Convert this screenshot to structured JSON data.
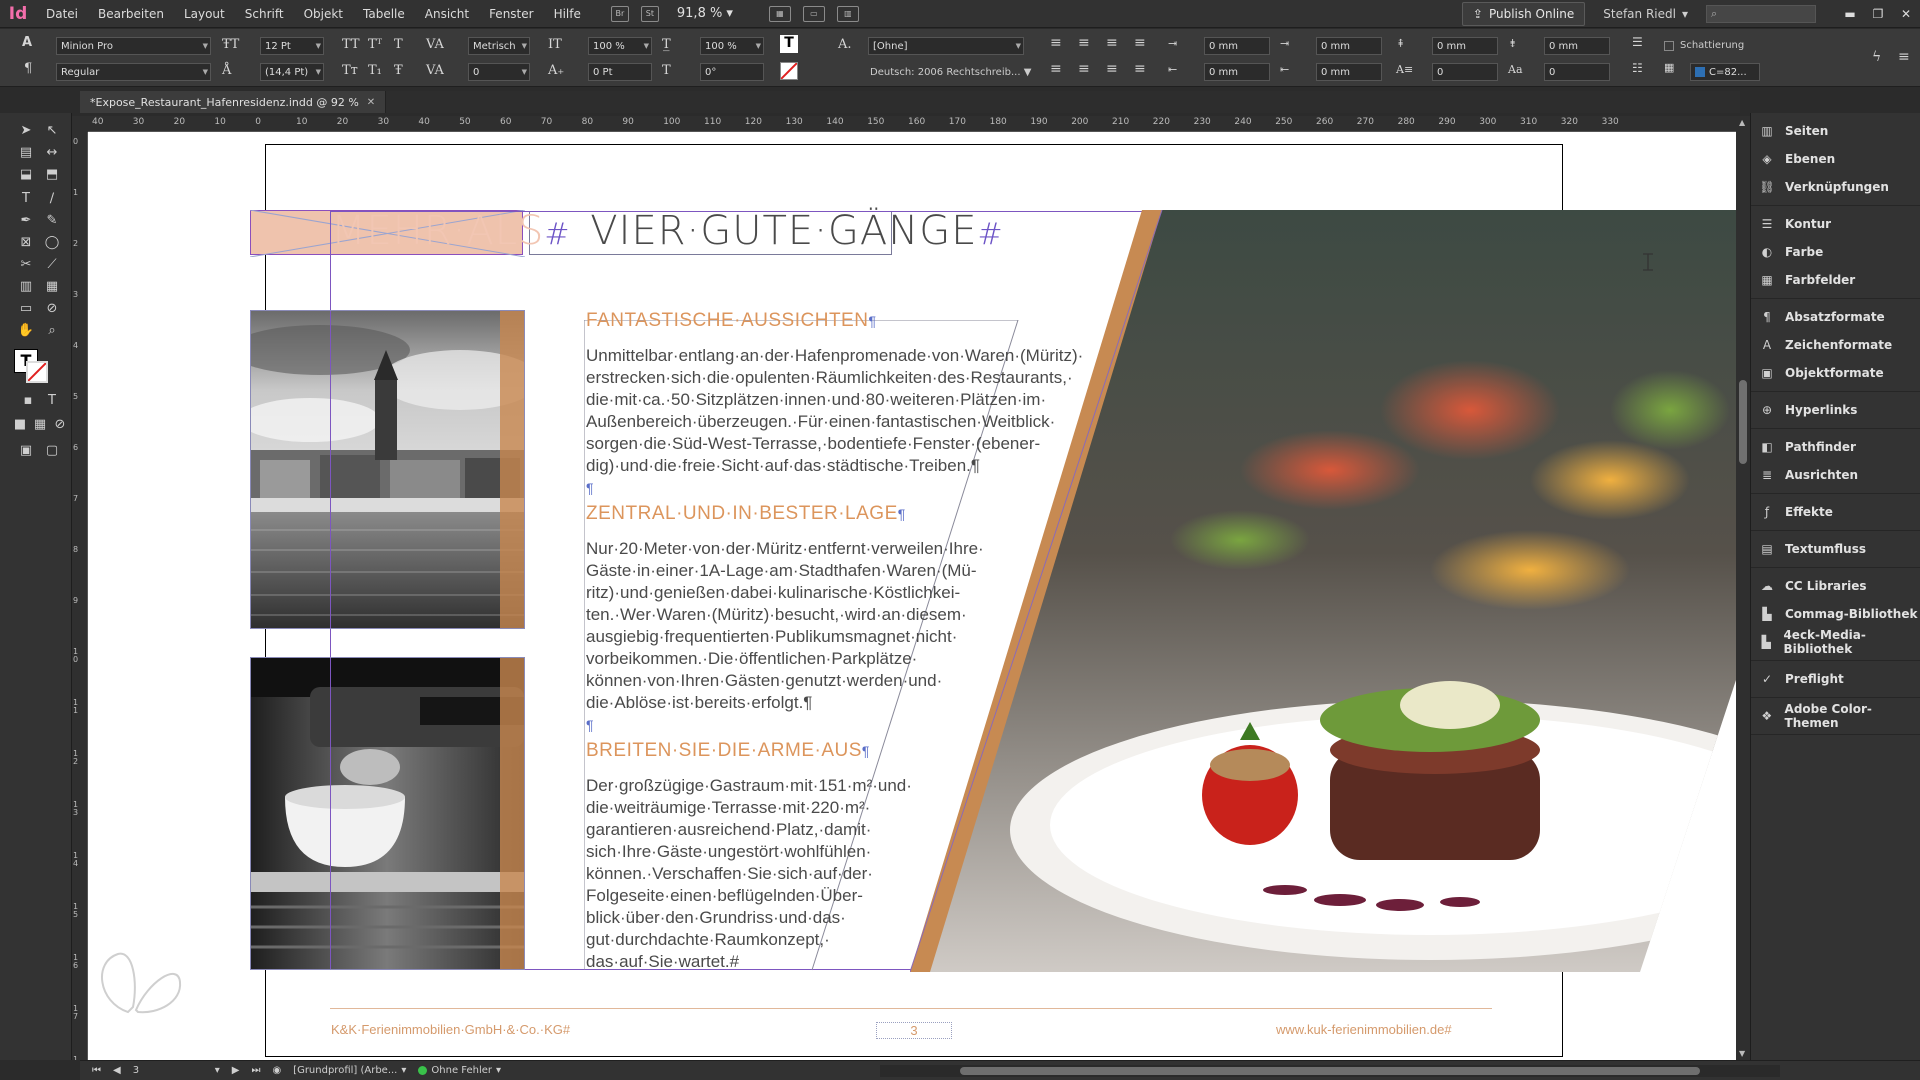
{
  "app": {
    "logo": "Id",
    "zoom": "91,8 %"
  },
  "menu": [
    "Datei",
    "Bearbeiten",
    "Layout",
    "Schrift",
    "Objekt",
    "Tabelle",
    "Ansicht",
    "Fenster",
    "Hilfe"
  ],
  "menubar_icons": {
    "br": "Br",
    "st": "St"
  },
  "publish_label": "Publish Online",
  "user": "Stefan Riedl",
  "control": {
    "font_family": "Minion Pro",
    "font_style": "Regular",
    "font_size": "12 Pt",
    "leading": "(14,4 Pt)",
    "kerning": "Metrisch",
    "tracking": "0",
    "scale_v": "100 %",
    "scale_h": "100 %",
    "baseline": "0 Pt",
    "skew": "0°",
    "char_style": "[Ohne]",
    "language": "Deutsch: 2006 Rechtschreib...",
    "indent_left": "0 mm",
    "indent_first": "0 mm",
    "indent_right": "0 mm",
    "indent_last": "0 mm",
    "space_before": "0 mm",
    "space_after": "0 mm",
    "drop_lines": "0",
    "drop_chars": "0",
    "shading_label": "Schattierung",
    "shading_color": "C=82..."
  },
  "doc_tab": "*Expose_Restaurant_Hafenresidenz.indd @ 92 %",
  "ruler_h": [
    "40",
    "30",
    "20",
    "10",
    "0",
    "10",
    "20",
    "30",
    "40",
    "50",
    "60",
    "70",
    "80",
    "90",
    "100",
    "110",
    "120",
    "130",
    "140",
    "150",
    "160",
    "170",
    "180",
    "190",
    "200",
    "210",
    "220",
    "230",
    "240",
    "250",
    "260",
    "270",
    "280",
    "290",
    "300",
    "310",
    "320",
    "330"
  ],
  "ruler_v": [
    "0",
    "1",
    "2",
    "3",
    "4",
    "5",
    "6",
    "7",
    "8",
    "9",
    "10",
    "11",
    "12",
    "13",
    "14",
    "15",
    "16",
    "17",
    "18",
    "19"
  ],
  "page": {
    "title_part1": "MEHR·ALS",
    "title_part2": "VIER·GUTE·GÄNGE",
    "hash": "#",
    "sections": [
      {
        "heading": "FANTASTISCHE·AUSSICHTEN",
        "lines": [
          "Unmittelbar·entlang·an·der·Hafenpromenade·von·Waren·(Müritz)·",
          "erstrecken·sich·die·opulenten·Räumlichkeiten·des·Restaurants,·",
          "die·mit·ca.·50·Sitzplätzen·innen·und·80·weiteren·Plätzen·im·",
          "Außenbereich·überzeugen.·Für·einen·fantastischen·Weitblick·",
          "sorgen·die·Süd-West-Terrasse,·bodentiefe·Fenster·(ebener-",
          "dig)·und·die·freie·Sicht·auf·das·städtische·Treiben.¶"
        ]
      },
      {
        "heading": "ZENTRAL·UND·IN·BESTER·LAGE",
        "lines": [
          "Nur·20·Meter·von·der·Müritz·entfernt·verweilen·Ihre·",
          "Gäste·in·einer·1A-Lage·am·Stadthafen·Waren·(Mü-",
          "ritz)·und·genießen·dabei·kulinarische·Köstlichkei-",
          "ten.·Wer·Waren·(Müritz)·besucht,·wird·an·diesem·",
          "ausgiebig·frequentierten·Publikumsmagnet·nicht·",
          "vorbeikommen.·Die·öffentlichen·Parkplätze·",
          "können·von·Ihren·Gästen·genutzt·werden·und·",
          "die·Ablöse·ist·bereits·erfolgt.¶"
        ]
      },
      {
        "heading": "BREITEN·SIE·DIE·ARME·AUS",
        "lines": [
          "Der·großzügige·Gastraum·mit·151·m²·und·",
          "die·weiträumige·Terrasse·mit·220·m²·",
          "garantieren·ausreichend·Platz,·damit·",
          "sich·Ihre·Gäste·ungestört·wohlfühlen·",
          "können.·Verschaffen·Sie·sich·auf·der·",
          "Folgeseite·einen·beflügelnden·Über-",
          "blick·über·den·Grundriss·und·das·",
          "gut·durchdachte·Raumkonzept,·",
          "das·auf·Sie·wartet.#"
        ]
      }
    ],
    "pilcrow": "¶",
    "footer_left": "K&K·Ferienimmobilien·GmbH·&·Co.·KG#",
    "footer_center": "3",
    "footer_right": "www.kuk-ferienimmobilien.de#"
  },
  "panels": [
    {
      "group": 1,
      "items": [
        {
          "label": "Seiten",
          "icon": "pages-icon"
        },
        {
          "label": "Ebenen",
          "icon": "layers-icon"
        },
        {
          "label": "Verknüpfungen",
          "icon": "links-icon"
        }
      ]
    },
    {
      "group": 2,
      "items": [
        {
          "label": "Kontur",
          "icon": "stroke-icon"
        },
        {
          "label": "Farbe",
          "icon": "color-icon"
        },
        {
          "label": "Farbfelder",
          "icon": "swatches-icon"
        }
      ]
    },
    {
      "group": 3,
      "items": [
        {
          "label": "Absatzformate",
          "icon": "paragraph-styles-icon"
        },
        {
          "label": "Zeichenformate",
          "icon": "character-styles-icon"
        },
        {
          "label": "Objektformate",
          "icon": "object-styles-icon"
        }
      ]
    },
    {
      "group": 4,
      "items": [
        {
          "label": "Hyperlinks",
          "icon": "hyperlinks-icon"
        }
      ]
    },
    {
      "group": 5,
      "items": [
        {
          "label": "Pathfinder",
          "icon": "pathfinder-icon"
        },
        {
          "label": "Ausrichten",
          "icon": "align-icon"
        }
      ]
    },
    {
      "group": 6,
      "items": [
        {
          "label": "Effekte",
          "icon": "effects-icon"
        }
      ]
    },
    {
      "group": 7,
      "items": [
        {
          "label": "Textumfluss",
          "icon": "text-wrap-icon"
        }
      ]
    },
    {
      "group": 8,
      "items": [
        {
          "label": "CC Libraries",
          "icon": "cc-libraries-icon"
        },
        {
          "label": "Commag-Bibliothek",
          "icon": "library-icon"
        },
        {
          "label": "4eck-Media-Bibliothek",
          "icon": "library-icon"
        }
      ]
    },
    {
      "group": 9,
      "items": [
        {
          "label": "Preflight",
          "icon": "preflight-icon"
        }
      ]
    },
    {
      "group": 10,
      "items": [
        {
          "label": "Adobe Color-Themen",
          "icon": "color-themes-icon"
        }
      ]
    }
  ],
  "status": {
    "page_number": "3",
    "profile": "[Grundprofil] (Arbe...",
    "errors": "Ohne Fehler"
  }
}
